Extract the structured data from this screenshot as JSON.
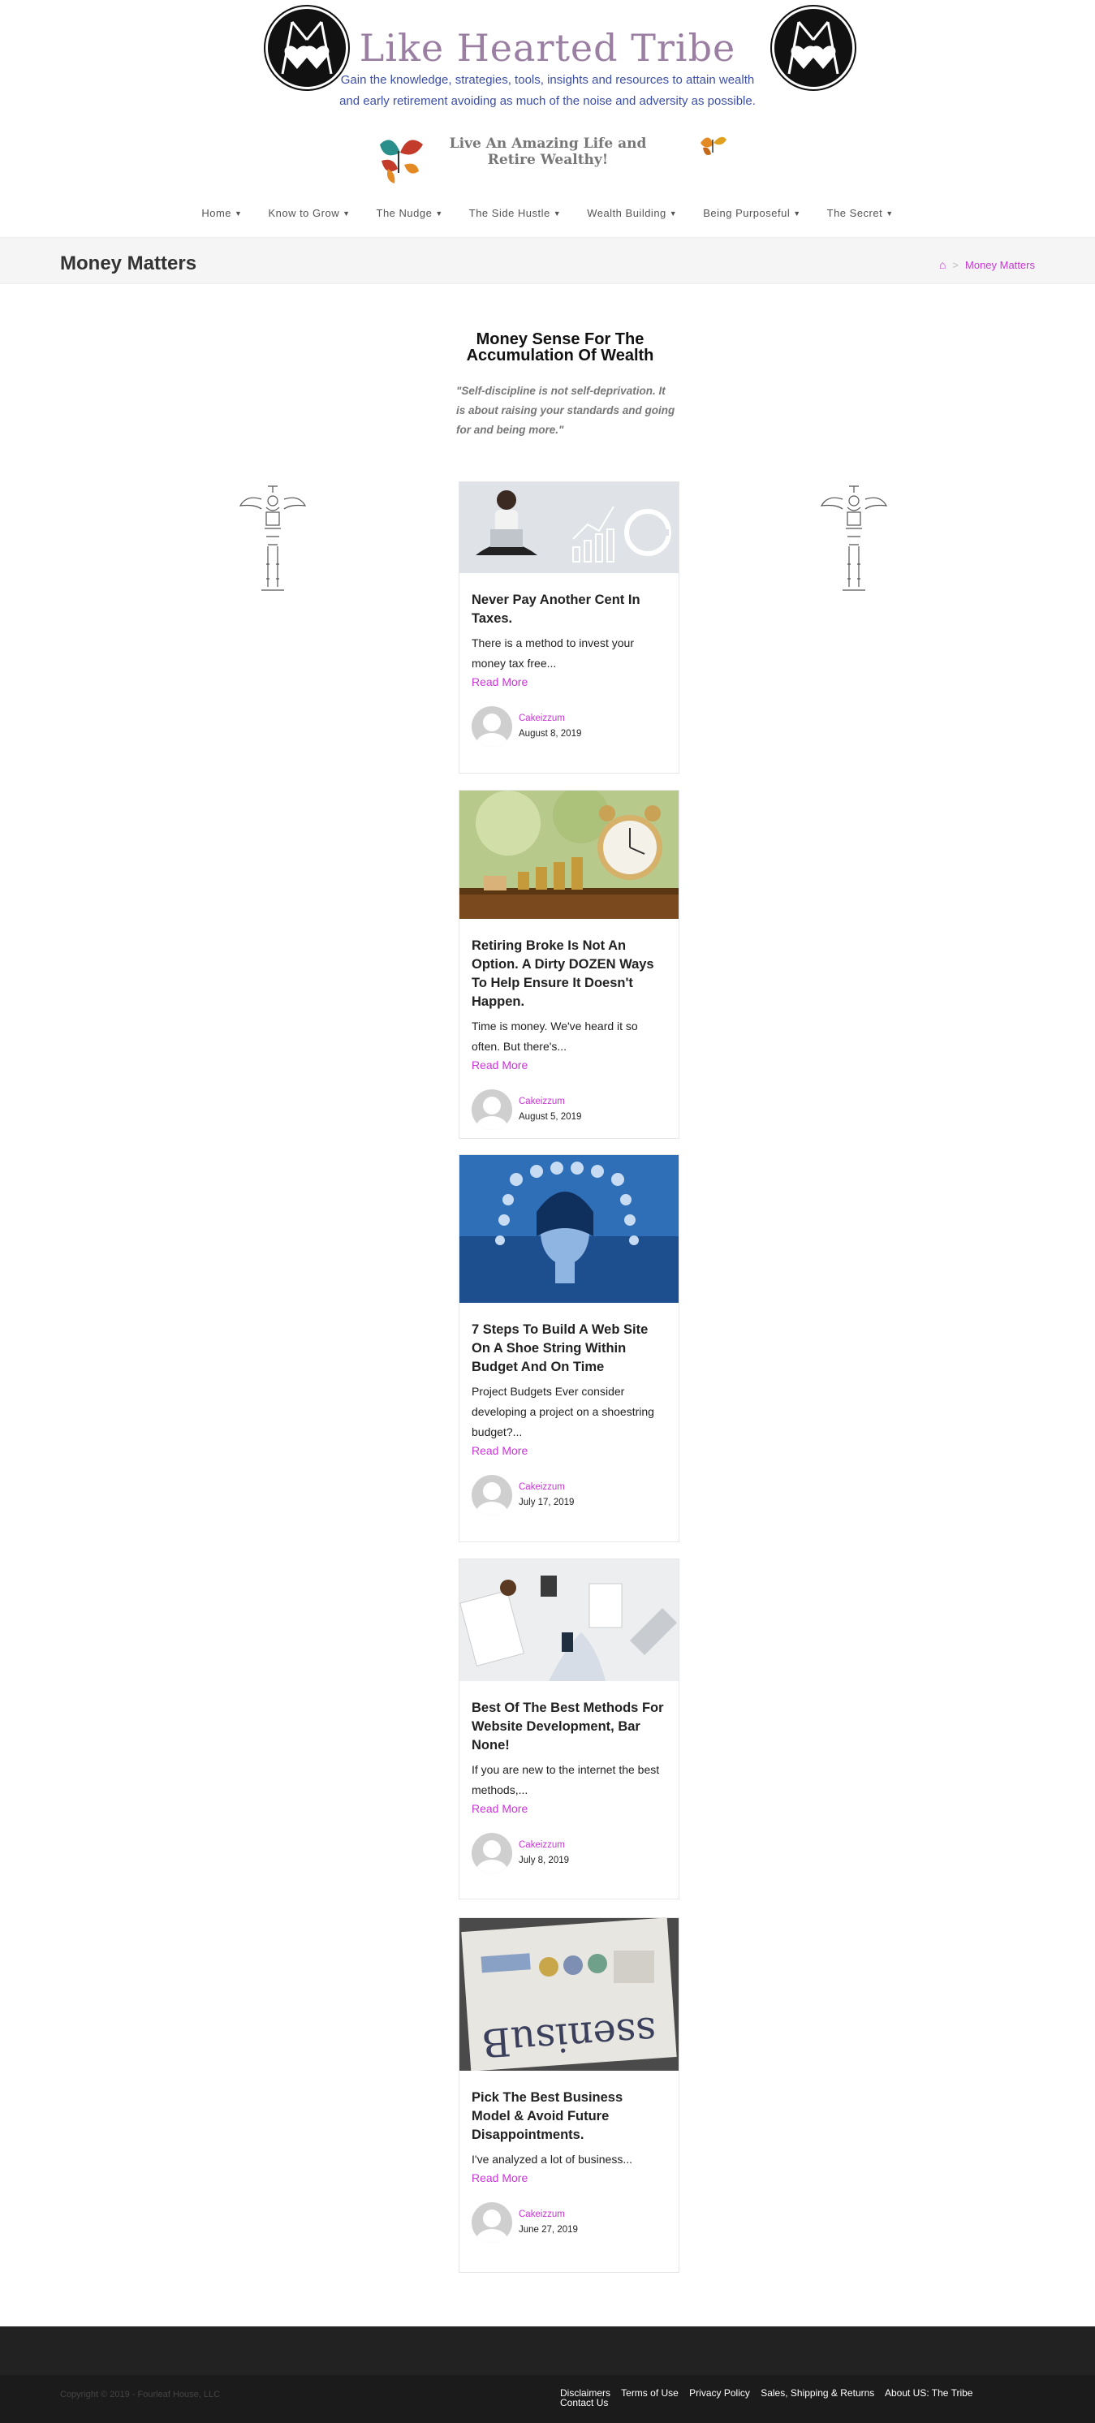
{
  "site": {
    "title": "Like Hearted Tribe",
    "tagline_line1": "Gain the knowledge, strategies, tools, insights and resources to attain wealth",
    "tagline_line2": "and early retirement avoiding as much of the noise and adversity as possible.",
    "subtagline": "Live An Amazing Life and Retire Wealthy!"
  },
  "nav": [
    {
      "label": "Home"
    },
    {
      "label": "Know to Grow"
    },
    {
      "label": "The Nudge"
    },
    {
      "label": "The Side Hustle"
    },
    {
      "label": "Wealth Building"
    },
    {
      "label": "Being Purposeful"
    },
    {
      "label": "The Secret"
    }
  ],
  "page": {
    "title": "Money Matters",
    "breadcrumb_current": "Money Matters"
  },
  "intro": {
    "title": "Money Sense For The Accumulation Of Wealth",
    "quote": "\"Self-discipline is not self-deprivation. It is about raising your standards and going for and being more.\""
  },
  "posts": [
    {
      "title": "Never Pay Another Cent In Taxes.",
      "excerpt": "There is a method to invest your money tax free...",
      "read_more": "Read More",
      "author": "Cakeizzum",
      "date": "August 8, 2019",
      "image": "woman-laptop-charts"
    },
    {
      "title": "Retiring Broke Is Not An Option. A Dirty DOZEN Ways To Help Ensure It Doesn't Happen.",
      "excerpt": "Time is money. We've heard it so often. But there's...",
      "read_more": "Read More",
      "author": "Cakeizzum",
      "date": "August 5, 2019",
      "image": "alarm-clock-coins"
    },
    {
      "title": "7 Steps To Build A Web Site On A Shoe String Within Budget And On Time",
      "excerpt": "Project Budgets Ever consider developing a project on a shoestring budget?...",
      "read_more": "Read More",
      "author": "Cakeizzum",
      "date": "July 17, 2019",
      "image": "woman-tech-icons"
    },
    {
      "title": "Best Of The Best Methods For Website Development, Bar None!",
      "excerpt": "If you are new to the internet the best methods,...",
      "read_more": "Read More",
      "author": "Cakeizzum",
      "date": "July 8, 2019",
      "image": "desk-workspace"
    },
    {
      "title": "Pick The Best Business Model & Avoid Future Disappointments.",
      "excerpt": "I've analyzed a lot of business...",
      "read_more": "Read More",
      "author": "Cakeizzum",
      "date": "June 27, 2019",
      "image": "business-newspaper"
    }
  ],
  "footer": {
    "copyright": "Copyright © 2019 - Fourleaf House, LLC",
    "links": [
      "Disclaimers",
      "Terms of Use",
      "Privacy Policy",
      "Sales, Shipping & Returns",
      "About US: The Tribe",
      "Contact Us"
    ]
  },
  "colors": {
    "accent": "#c936d6",
    "title": "#9a7fa3",
    "tagline": "#3b4fa8"
  }
}
